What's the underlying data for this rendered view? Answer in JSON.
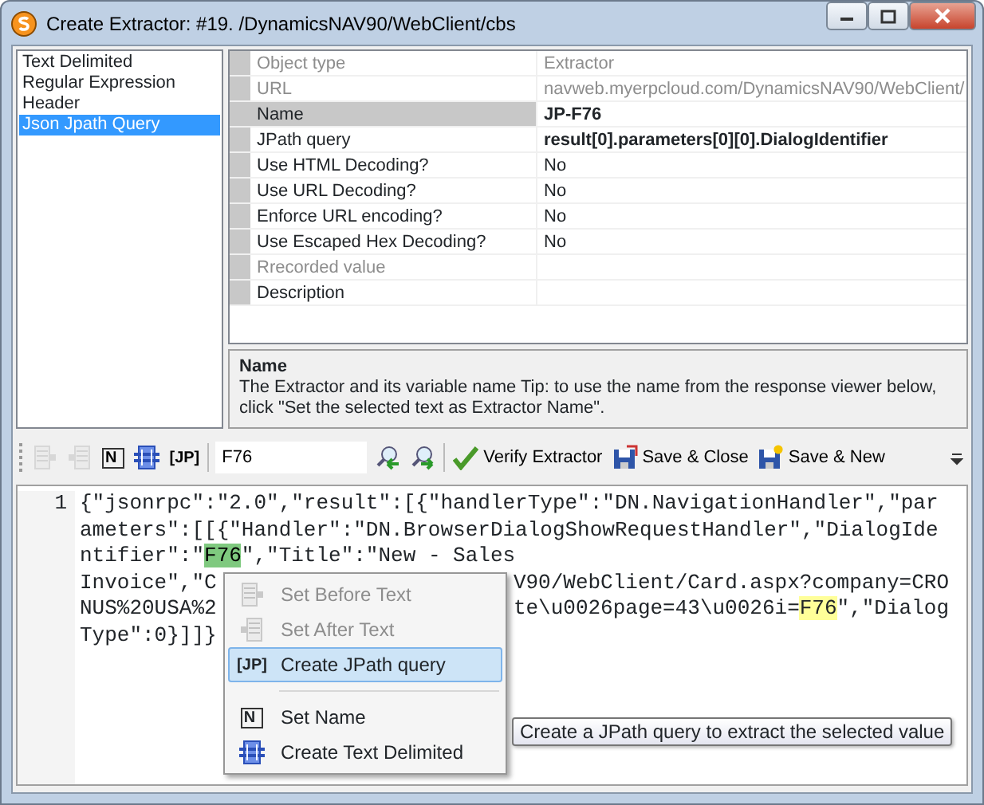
{
  "window": {
    "title": "Create Extractor: #19. /DynamicsNAV90/WebClient/cbs"
  },
  "extractor_types": [
    {
      "label": "Text Delimited",
      "selected": false
    },
    {
      "label": "Regular Expression",
      "selected": false
    },
    {
      "label": "Header",
      "selected": false
    },
    {
      "label": "Json Jpath Query",
      "selected": true
    }
  ],
  "properties": [
    {
      "label": "Object type",
      "value": "Extractor",
      "disabled": true,
      "bold": false,
      "selected": false
    },
    {
      "label": "URL",
      "value": "navweb.myerpcloud.com/DynamicsNAV90/WebClient/",
      "disabled": true,
      "bold": false,
      "selected": false
    },
    {
      "label": "Name",
      "value": "JP-F76",
      "disabled": false,
      "bold": true,
      "selected": true
    },
    {
      "label": "JPath query",
      "value": "result[0].parameters[0][0].DialogIdentifier",
      "disabled": false,
      "bold": true,
      "selected": false
    },
    {
      "label": "Use HTML Decoding?",
      "value": "No",
      "disabled": false,
      "bold": false,
      "selected": false
    },
    {
      "label": "Use URL Decoding?",
      "value": "No",
      "disabled": false,
      "bold": false,
      "selected": false
    },
    {
      "label": "Enforce URL encoding?",
      "value": "No",
      "disabled": false,
      "bold": false,
      "selected": false
    },
    {
      "label": "Use Escaped Hex Decoding?",
      "value": "No",
      "disabled": false,
      "bold": false,
      "selected": false
    },
    {
      "label": "Rrecorded value",
      "disabled": true,
      "selected": false
    },
    {
      "label": "Description",
      "disabled": false,
      "selected": false
    }
  ],
  "help": {
    "title": "Name",
    "text": "The Extractor and its variable name Tip: to use the name from the response viewer below, click \"Set the selected text as Extractor Name\"."
  },
  "toolbar": {
    "tools": [
      {
        "kind": "before",
        "disabled": true
      },
      {
        "kind": "after",
        "disabled": true
      },
      {
        "kind": "name",
        "text": "N",
        "disabled": false
      },
      {
        "kind": "delimited",
        "disabled": false
      },
      {
        "kind": "jpath",
        "text": "[JP]",
        "disabled": false
      }
    ],
    "search_value": "F76",
    "buttons": [
      {
        "kind": "find-prev"
      },
      {
        "kind": "find-next"
      },
      {
        "kind": "verify",
        "label": "Verify Extractor"
      },
      {
        "kind": "save-close",
        "label": "Save & Close"
      },
      {
        "kind": "save-new",
        "label": "Save & New"
      }
    ]
  },
  "response": {
    "line_number": "1",
    "rows": [
      [
        [
          {
            "text": "{\"jsonrpc\":\"2.0\",\"result\":[{\"handlerType\":\"DN.NavigationHandler\",\"par"
          }
        ]
      ],
      [
        [
          {
            "text": "ameters\":[[{\"Handler\":\"DN.BrowserDialogShowRequestHandler\",\"DialogIde"
          }
        ]
      ],
      [
        [
          {
            "text": "ntifier\":\""
          },
          {
            "text": "F76",
            "selected": true
          },
          {
            "text": "\",\"Title\":\"New - Sales"
          }
        ]
      ],
      [
        [
          {
            "text": "Invoice\",\"C"
          }
        ],
        [
          {
            "text": "V90/WebClient/Card.aspx?company=CRO"
          }
        ]
      ],
      [
        [
          {
            "text": "NUS%20USA%2"
          }
        ],
        [
          {
            "text": "te\\u0026page=43\\u0026i="
          },
          {
            "text": "F76",
            "highlighted": true
          },
          {
            "text": "\",\"Dialog"
          }
        ]
      ],
      [
        [
          {
            "text": "Type\":0}]]}"
          }
        ]
      ]
    ]
  },
  "context_menu": [
    {
      "kind": "before",
      "label": "Set Before Text",
      "disabled": true,
      "selected": false
    },
    {
      "kind": "after",
      "label": "Set After Text",
      "disabled": true,
      "selected": false
    },
    {
      "kind": "jpath",
      "icon_text": "[JP]",
      "label": "Create JPath query",
      "disabled": false,
      "selected": true
    },
    {
      "kind": "separator"
    },
    {
      "kind": "name",
      "icon_text": "N",
      "label": "Set Name",
      "disabled": false,
      "selected": false
    },
    {
      "kind": "delimited",
      "label": "Create Text Delimited",
      "disabled": false,
      "selected": false
    }
  ],
  "tooltip": "Create a JPath query to extract the selected value"
}
